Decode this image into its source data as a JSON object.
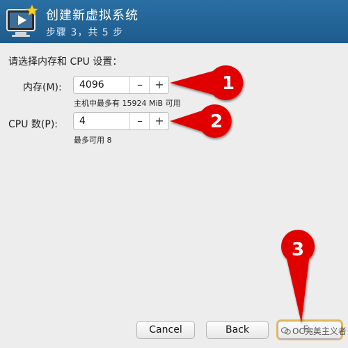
{
  "header": {
    "title": "创建新虚拟系统",
    "subtitle": "步骤 3，共 5 步",
    "icon": "monitor-play-icon"
  },
  "body": {
    "prompt": "请选择内存和 CPU 设置：",
    "memory": {
      "label": "内存(M):",
      "value": "4096",
      "hint": "主机中最多有 15924 MiB 可用",
      "decrement": "–",
      "increment": "+"
    },
    "cpu": {
      "label": "CPU 数(P):",
      "value": "4",
      "hint": "最多可用 8",
      "decrement": "–",
      "increment": "+"
    }
  },
  "footer": {
    "cancel": "Cancel",
    "back": "Back",
    "forward": "F..."
  },
  "annotations": [
    {
      "number": "1"
    },
    {
      "number": "2"
    },
    {
      "number": "3"
    }
  ],
  "watermark": "OC完美主义者",
  "colors": {
    "header": "#2a6fa3",
    "marker": "#e00000"
  }
}
